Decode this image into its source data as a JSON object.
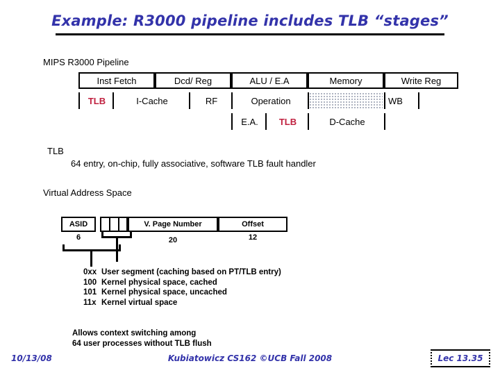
{
  "slide": {
    "title": "Example: R3000 pipeline includes TLB “stages”",
    "accent_color": "#3333AA",
    "tlb_color": "#C0203F"
  },
  "pipeline": {
    "label": "MIPS R3000 Pipeline",
    "stages": [
      {
        "header": "Inst Fetch"
      },
      {
        "header": "Dcd/ Reg"
      },
      {
        "header": "ALU / E.A"
      },
      {
        "header": "Memory"
      },
      {
        "header": "Write Reg"
      }
    ],
    "row2": [
      {
        "text": "TLB",
        "highlight": true
      },
      {
        "text": "I-Cache",
        "highlight": false
      },
      {
        "text": "RF",
        "highlight": false
      },
      {
        "text": "Operation",
        "highlight": false
      },
      {
        "text": "WB",
        "highlight": false
      }
    ],
    "row3": [
      {
        "text": "E.A.",
        "highlight": false
      },
      {
        "text": "TLB",
        "highlight": true
      },
      {
        "text": "D-Cache",
        "highlight": false
      }
    ],
    "memory_stall_fill": "dotted-hatch"
  },
  "tlb": {
    "heading": "TLB",
    "description": "64 entry, on-chip,  fully associative, software TLB fault handler"
  },
  "virtual_address": {
    "heading": "Virtual Address Space",
    "fields": [
      {
        "name": "ASID",
        "width": "6"
      },
      {
        "name": "",
        "width": ""
      },
      {
        "name": "V. Page Number",
        "width": "20"
      },
      {
        "name": "Offset",
        "width": "12"
      }
    ]
  },
  "segments": [
    {
      "code": "0xx",
      "text": "User segment (caching based on PT/TLB entry)"
    },
    {
      "code": "100",
      "text": "Kernel physical space, cached"
    },
    {
      "code": "101",
      "text": "Kernel physical space, uncached"
    },
    {
      "code": "11x",
      "text": "Kernel virtual space"
    }
  ],
  "context_note": [
    "Allows context switching among",
    "64 user processes without TLB flush"
  ],
  "footer": {
    "date": "10/13/08",
    "center": "Kubiatowicz CS162 ©UCB Fall 2008",
    "lecture": "Lec 13.35"
  }
}
